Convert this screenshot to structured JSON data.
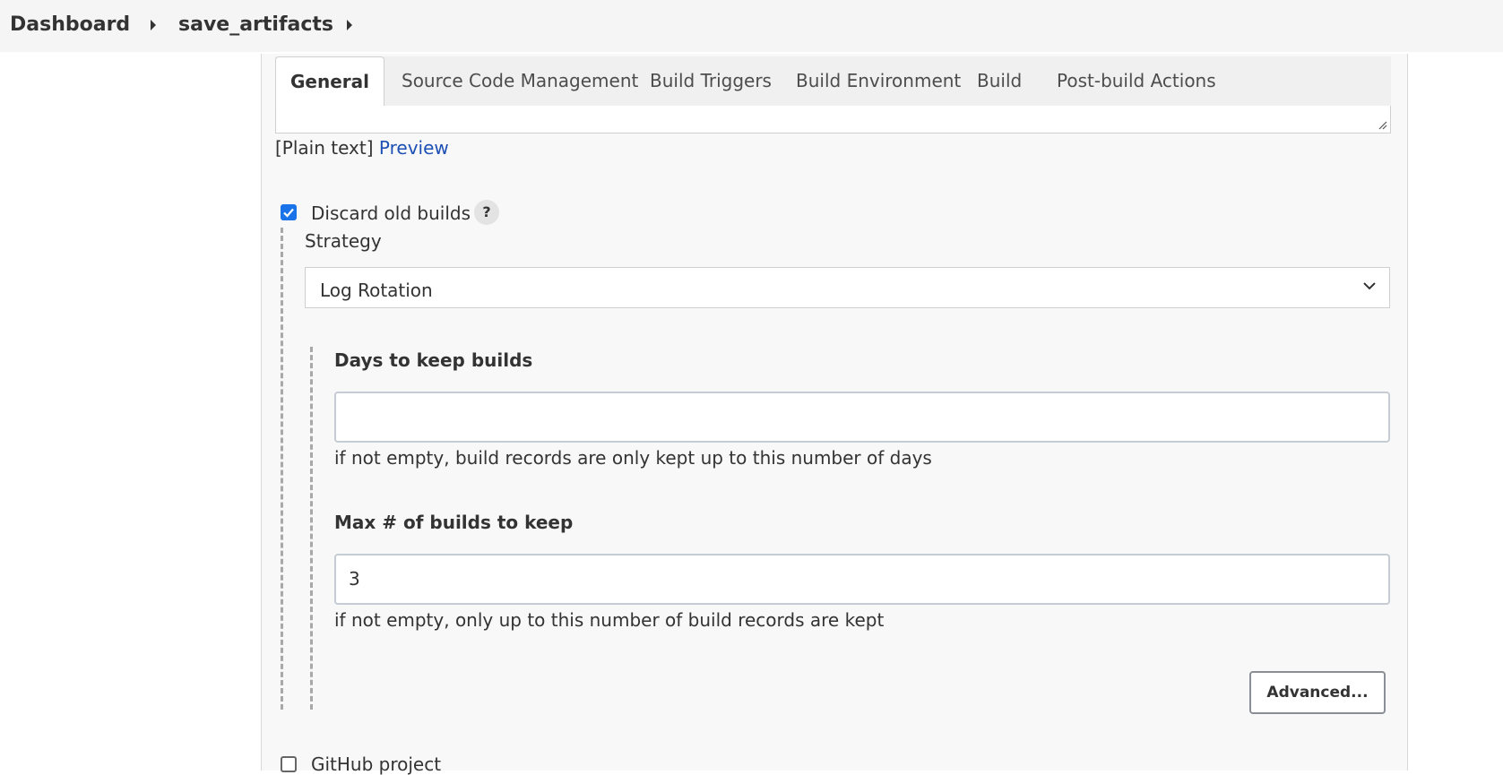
{
  "breadcrumb": {
    "items": [
      "Dashboard",
      "save_artifacts"
    ]
  },
  "tabs": [
    {
      "label": "General",
      "active": true
    },
    {
      "label": "Source Code Management"
    },
    {
      "label": "Build Triggers"
    },
    {
      "label": "Build Environment"
    },
    {
      "label": "Build"
    },
    {
      "label": "Post-build Actions"
    }
  ],
  "description": {
    "format_label": "[Plain text]",
    "preview_label": "Preview"
  },
  "discard_old_builds": {
    "label": "Discard old builds",
    "checked": true,
    "help": "?",
    "strategy_label": "Strategy",
    "strategy_value": "Log Rotation",
    "days_label": "Days to keep builds",
    "days_value": "",
    "days_hint": "if not empty, build records are only kept up to this number of days",
    "max_label": "Max # of builds to keep",
    "max_value": "3",
    "max_hint": "if not empty, only up to this number of build records are kept",
    "advanced_label": "Advanced..."
  },
  "github_project": {
    "label": "GitHub project",
    "checked": false
  },
  "colors": {
    "accent": "#1a73e8",
    "link": "#1d4fb4"
  }
}
